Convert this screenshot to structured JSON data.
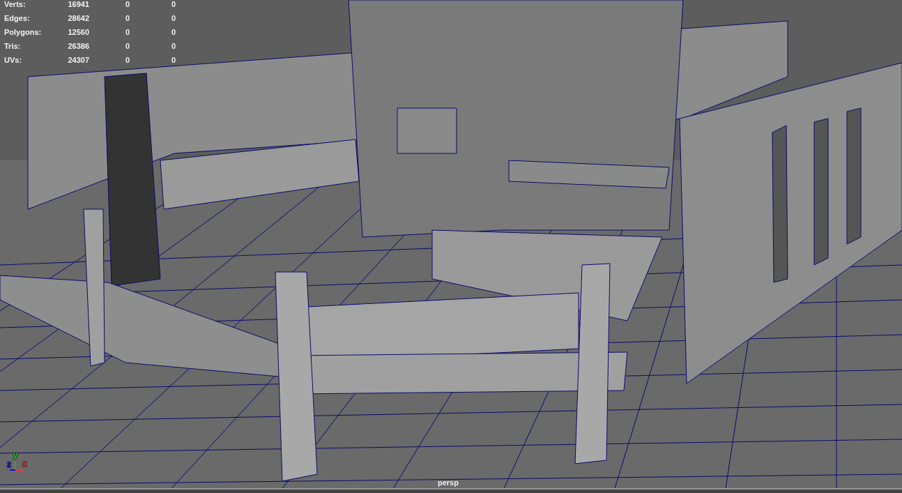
{
  "hud": {
    "rows": [
      {
        "label": "Verts:",
        "values": [
          "16941",
          "0",
          "0"
        ]
      },
      {
        "label": "Edges:",
        "values": [
          "28642",
          "0",
          "0"
        ]
      },
      {
        "label": "Polygons:",
        "values": [
          "12560",
          "0",
          "0"
        ]
      },
      {
        "label": "Tris:",
        "values": [
          "26386",
          "0",
          "0"
        ]
      },
      {
        "label": "UVs:",
        "values": [
          "24307",
          "0",
          "0"
        ]
      }
    ]
  },
  "axes": [
    {
      "label": "y",
      "color": "#22cc22"
    },
    {
      "label": "z",
      "color": "#1010dd"
    },
    {
      "label": "x",
      "color": "#ff3030"
    }
  ],
  "camera": "persp"
}
